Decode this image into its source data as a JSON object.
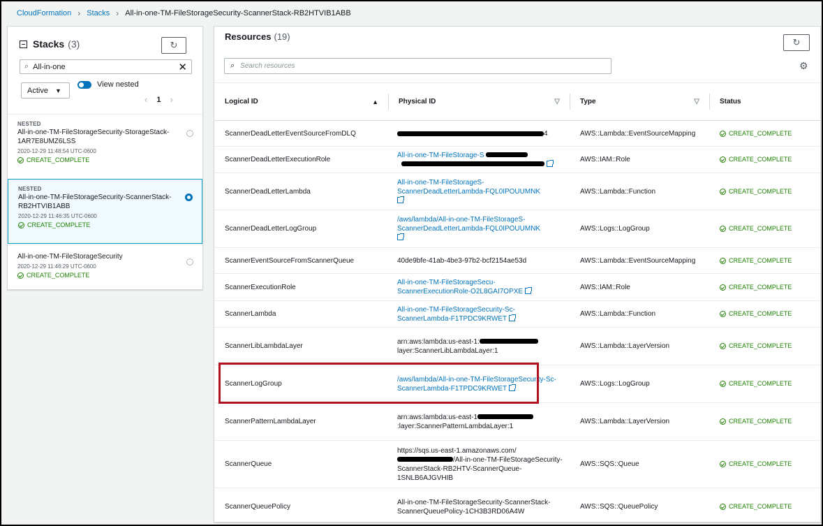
{
  "breadcrumb": {
    "items": [
      "CloudFormation",
      "Stacks"
    ],
    "current": "All-in-one-TM-FileStorageSecurity-ScannerStack-RB2HTVIB1ABB"
  },
  "stacks": {
    "title": "Stacks",
    "count": "(3)",
    "search_value": "All-in-one",
    "status_filter": "Active",
    "view_nested_label": "View nested",
    "page": "1",
    "items": [
      {
        "tag": "NESTED",
        "name": "All-in-one-TM-FileStorageSecurity-StorageStack-1AR7E8UMZ6LSS",
        "date": "2020-12-29 11:48:54 UTC-0600",
        "status": "CREATE_COMPLETE",
        "selected": false
      },
      {
        "tag": "NESTED",
        "name": "All-in-one-TM-FileStorageSecurity-ScannerStack-RB2HTVIB1ABB",
        "date": "2020-12-29 11:46:35 UTC-0600",
        "status": "CREATE_COMPLETE",
        "selected": true
      },
      {
        "tag": "",
        "name": "All-in-one-TM-FileStorageSecurity",
        "date": "2020-12-29 11:46:29 UTC-0600",
        "status": "CREATE_COMPLETE",
        "selected": false
      }
    ]
  },
  "resources": {
    "title": "Resources",
    "count": "(19)",
    "search_placeholder": "Search resources",
    "columns": [
      "Logical ID",
      "Physical ID",
      "Type",
      "Status"
    ],
    "rows": [
      {
        "logical_id": "ScannerDeadLetterEventSourceFromDLQ",
        "physical_id": "4",
        "physical_is_link": false,
        "type": "AWS::Lambda::EventSourceMapping",
        "status": "CREATE_COMPLETE"
      },
      {
        "logical_id": "ScannerDeadLetterExecutionRole",
        "physical_id": "All-in-one-TM-FileStorage-S",
        "physical_is_link": true,
        "type": "AWS::IAM::Role",
        "status": "CREATE_COMPLETE"
      },
      {
        "logical_id": "ScannerDeadLetterLambda",
        "physical_id": "All-in-one-TM-FileStorageS-ScannerDeadLetterLambda-FQL0IPOUUMNK",
        "physical_is_link": true,
        "type": "AWS::Lambda::Function",
        "status": "CREATE_COMPLETE"
      },
      {
        "logical_id": "ScannerDeadLetterLogGroup",
        "physical_id": "/aws/lambda/All-in-one-TM-FileStorageS-ScannerDeadLetterLambda-FQL0IPOUUMNK",
        "physical_is_link": true,
        "type": "AWS::Logs::LogGroup",
        "status": "CREATE_COMPLETE"
      },
      {
        "logical_id": "ScannerEventSourceFromScannerQueue",
        "physical_id": "40de9bfe-41ab-4be3-97b2-bcf2154ae53d",
        "physical_is_link": false,
        "type": "AWS::Lambda::EventSourceMapping",
        "status": "CREATE_COMPLETE"
      },
      {
        "logical_id": "ScannerExecutionRole",
        "physical_id": "All-in-one-TM-FileStorageSecu-ScannerExecutionRole-O2L8GAI7OPXE",
        "physical_is_link": true,
        "type": "AWS::IAM::Role",
        "status": "CREATE_COMPLETE"
      },
      {
        "logical_id": "ScannerLambda",
        "physical_id": "All-in-one-TM-FileStorageSecurity-Sc-ScannerLambda-F1TPDC9KRWET",
        "physical_is_link": true,
        "type": "AWS::Lambda::Function",
        "status": "CREATE_COMPLETE"
      },
      {
        "logical_id": "ScannerLibLambdaLayer",
        "physical_id_prefix": "arn:aws:lambda:us-east-1:",
        "physical_id_suffix": "layer:ScannerLibLambdaLayer:1",
        "physical_is_link": false,
        "type": "AWS::Lambda::LayerVersion",
        "status": "CREATE_COMPLETE"
      },
      {
        "logical_id": "ScannerLogGroup",
        "physical_id": "/aws/lambda/All-in-one-TM-FileStorageSecurity-Sc-ScannerLambda-F1TPDC9KRWET",
        "physical_is_link": true,
        "type": "AWS::Logs::LogGroup",
        "status": "CREATE_COMPLETE",
        "highlighted": true
      },
      {
        "logical_id": "ScannerPatternLambdaLayer",
        "physical_id_prefix": "arn:aws:lambda:us-east-1",
        "physical_id_suffix": ":layer:ScannerPatternLambdaLayer:1",
        "physical_is_link": false,
        "type": "AWS::Lambda::LayerVersion",
        "status": "CREATE_COMPLETE"
      },
      {
        "logical_id": "ScannerQueue",
        "physical_id_prefix": "https://sqs.us-east-1.amazonaws.com/",
        "physical_id_suffix": "/All-in-one-TM-FileStorageSecurity-ScannerStack-RB2HTV-ScannerQueue-1SNLB6AJGVHIB",
        "physical_is_link": false,
        "type": "AWS::SQS::Queue",
        "status": "CREATE_COMPLETE"
      },
      {
        "logical_id": "ScannerQueuePolicy",
        "physical_id": "All-in-one-TM-FileStorageSecurity-ScannerStack-ScannerQueuePolicy-1CH3B3RD06A4W",
        "physical_is_link": false,
        "type": "AWS::SQS::QueuePolicy",
        "status": "CREATE_COMPLETE"
      }
    ]
  },
  "colors": {
    "link": "#0073bb",
    "success": "#1d8102",
    "highlight": "#b0101f",
    "selected_border": "#00a1c9"
  }
}
